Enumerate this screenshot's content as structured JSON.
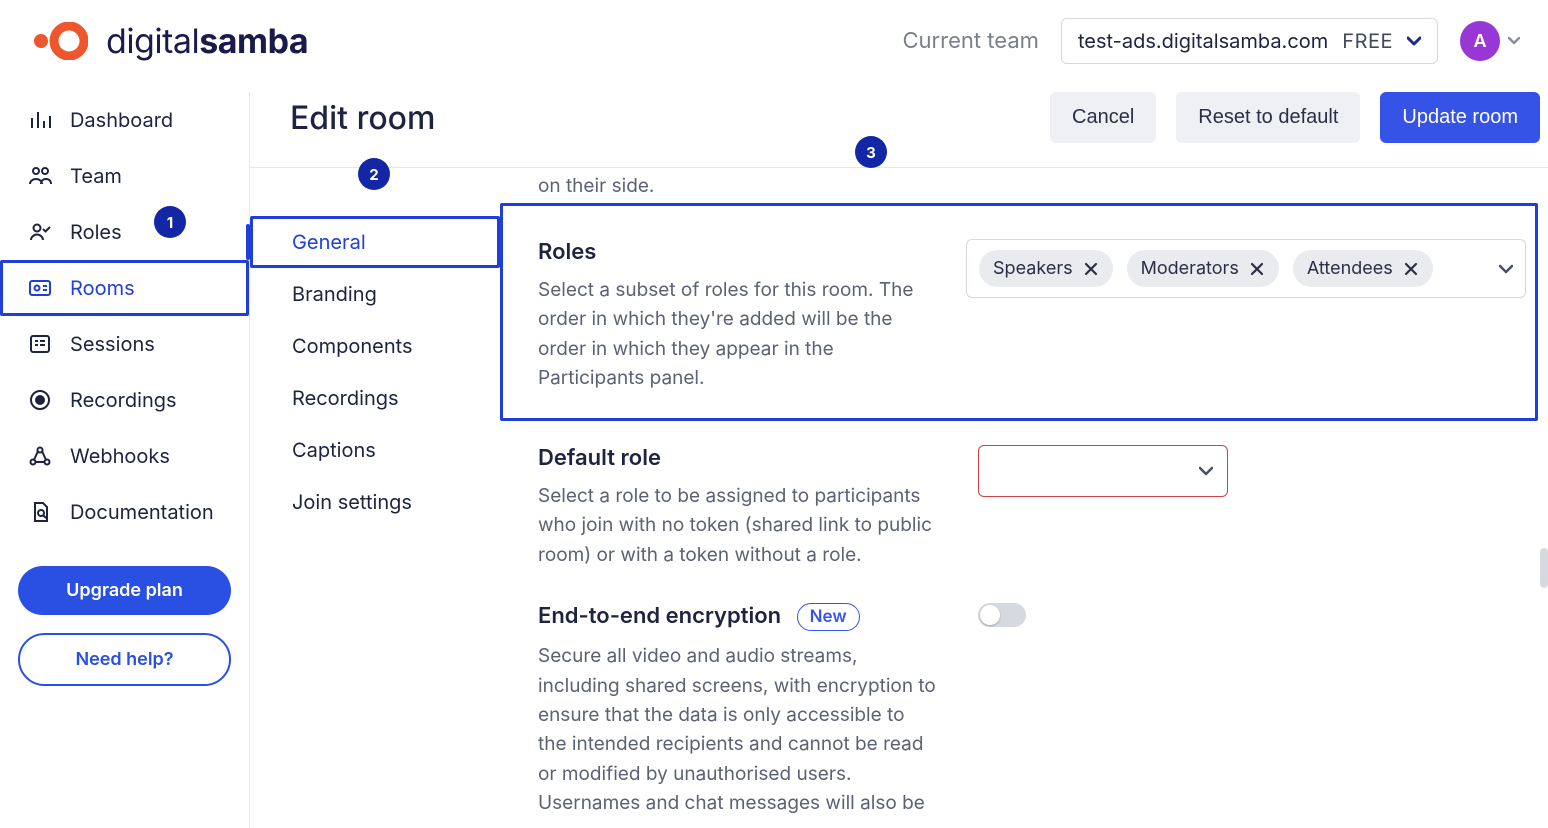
{
  "brand": {
    "name_light": "digital",
    "name_bold": "samba"
  },
  "header": {
    "current_team_label": "Current team",
    "team_domain": "test-ads.digitalsamba.com",
    "team_plan": "FREE",
    "avatar_initial": "A"
  },
  "sidebar": {
    "items": [
      {
        "label": "Dashboard",
        "icon": "bar-chart-icon"
      },
      {
        "label": "Team",
        "icon": "people-icon"
      },
      {
        "label": "Roles",
        "icon": "person-check-icon"
      },
      {
        "label": "Rooms",
        "icon": "id-card-icon"
      },
      {
        "label": "Sessions",
        "icon": "list-icon"
      },
      {
        "label": "Recordings",
        "icon": "record-icon"
      },
      {
        "label": "Webhooks",
        "icon": "webhook-icon"
      },
      {
        "label": "Documentation",
        "icon": "doc-search-icon"
      }
    ],
    "upgrade_label": "Upgrade plan",
    "help_label": "Need help?"
  },
  "page": {
    "title": "Edit room",
    "actions": {
      "cancel": "Cancel",
      "reset": "Reset to default",
      "update": "Update room"
    },
    "tabs": [
      {
        "label": "General"
      },
      {
        "label": "Branding"
      },
      {
        "label": "Components"
      },
      {
        "label": "Recordings"
      },
      {
        "label": "Captions"
      },
      {
        "label": "Join settings"
      }
    ],
    "cutoff_text": "on their side.",
    "roles": {
      "title": "Roles",
      "desc": "Select a subset of roles for this room. The order in which they're added will be the order in which they appear in the Participants panel.",
      "chips": [
        "Speakers",
        "Moderators",
        "Attendees"
      ]
    },
    "default_role": {
      "title": "Default role",
      "desc": "Select a role to be assigned to participants who join with no token (shared link to public room) or with a token without a role."
    },
    "e2ee": {
      "title": "End-to-end encryption",
      "badge": "New",
      "desc": "Secure all video and audio streams, including shared screens, with encryption to ensure that the data is only accessible to the intended recipients and cannot be read or modified by unauthorised users. Usernames and chat messages will also be"
    }
  },
  "annotations": {
    "one": "1",
    "two": "2",
    "three": "3"
  }
}
